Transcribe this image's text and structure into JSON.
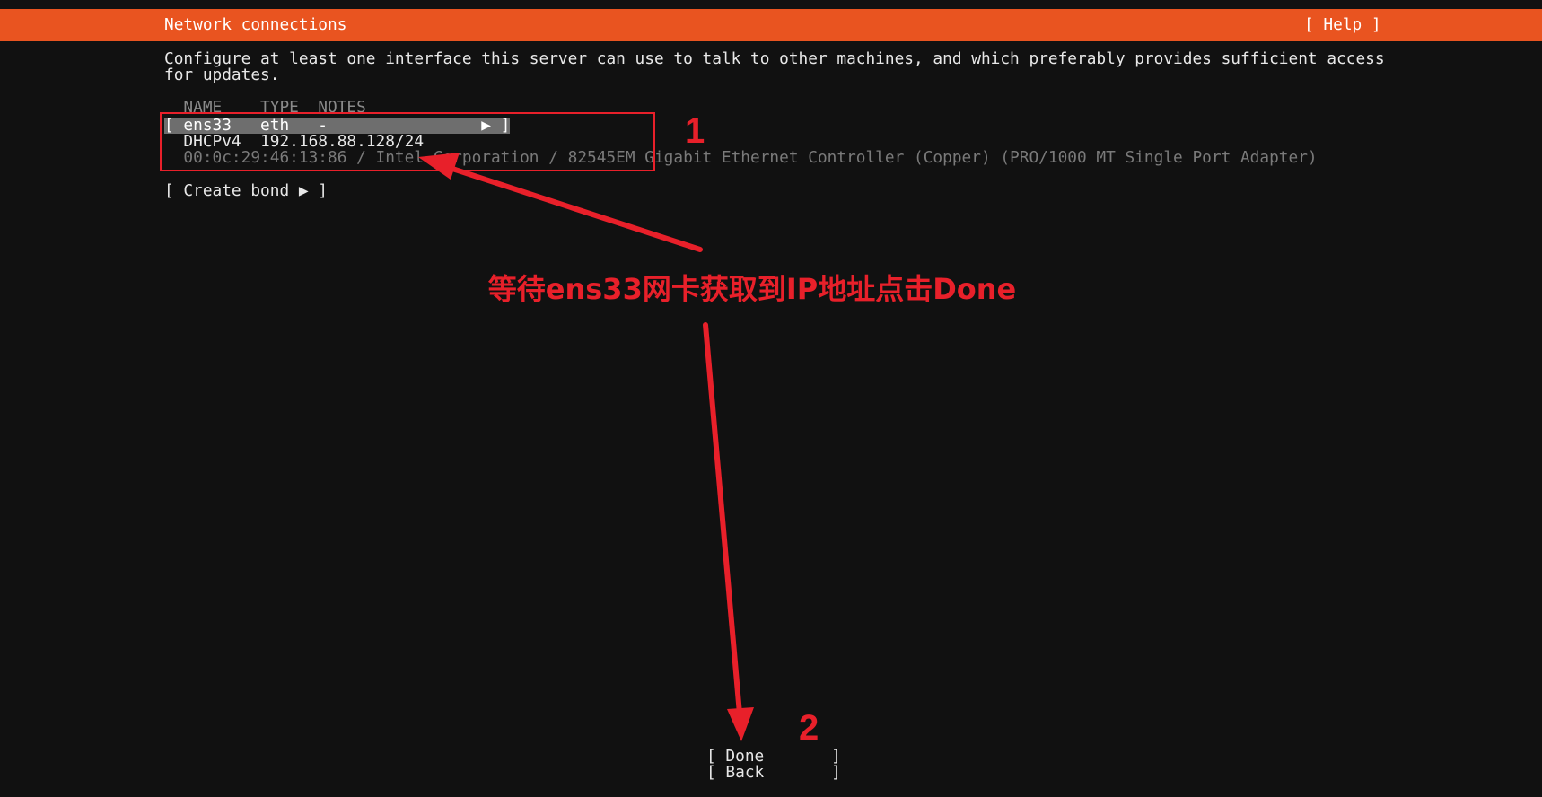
{
  "header": {
    "title": "Network connections",
    "help_label": "[ Help ]",
    "accent_color": "#e95420"
  },
  "description": "Configure at least one interface this server can use to talk to other machines, and which preferably provides sufficient access for updates.",
  "table": {
    "columns": [
      "NAME",
      "TYPE",
      "NOTES"
    ],
    "interfaces": [
      {
        "name": "ens33",
        "type": "eth",
        "notes": "-",
        "address_method": "DHCPv4",
        "address": "192.168.88.128/24",
        "hardware": "00:0c:29:46:13:86 / Intel Corporation / 82545EM Gigabit Ethernet Controller (Copper) (PRO/1000 MT Single Port Adapter)"
      }
    ]
  },
  "create_bond_label": "Create bond",
  "buttons": {
    "done": "Done",
    "back": "Back"
  },
  "annotations": {
    "step1": "1",
    "step2": "2",
    "note": "等待ens33网卡获取到IP地址点击Done",
    "color": "#e8202a"
  }
}
